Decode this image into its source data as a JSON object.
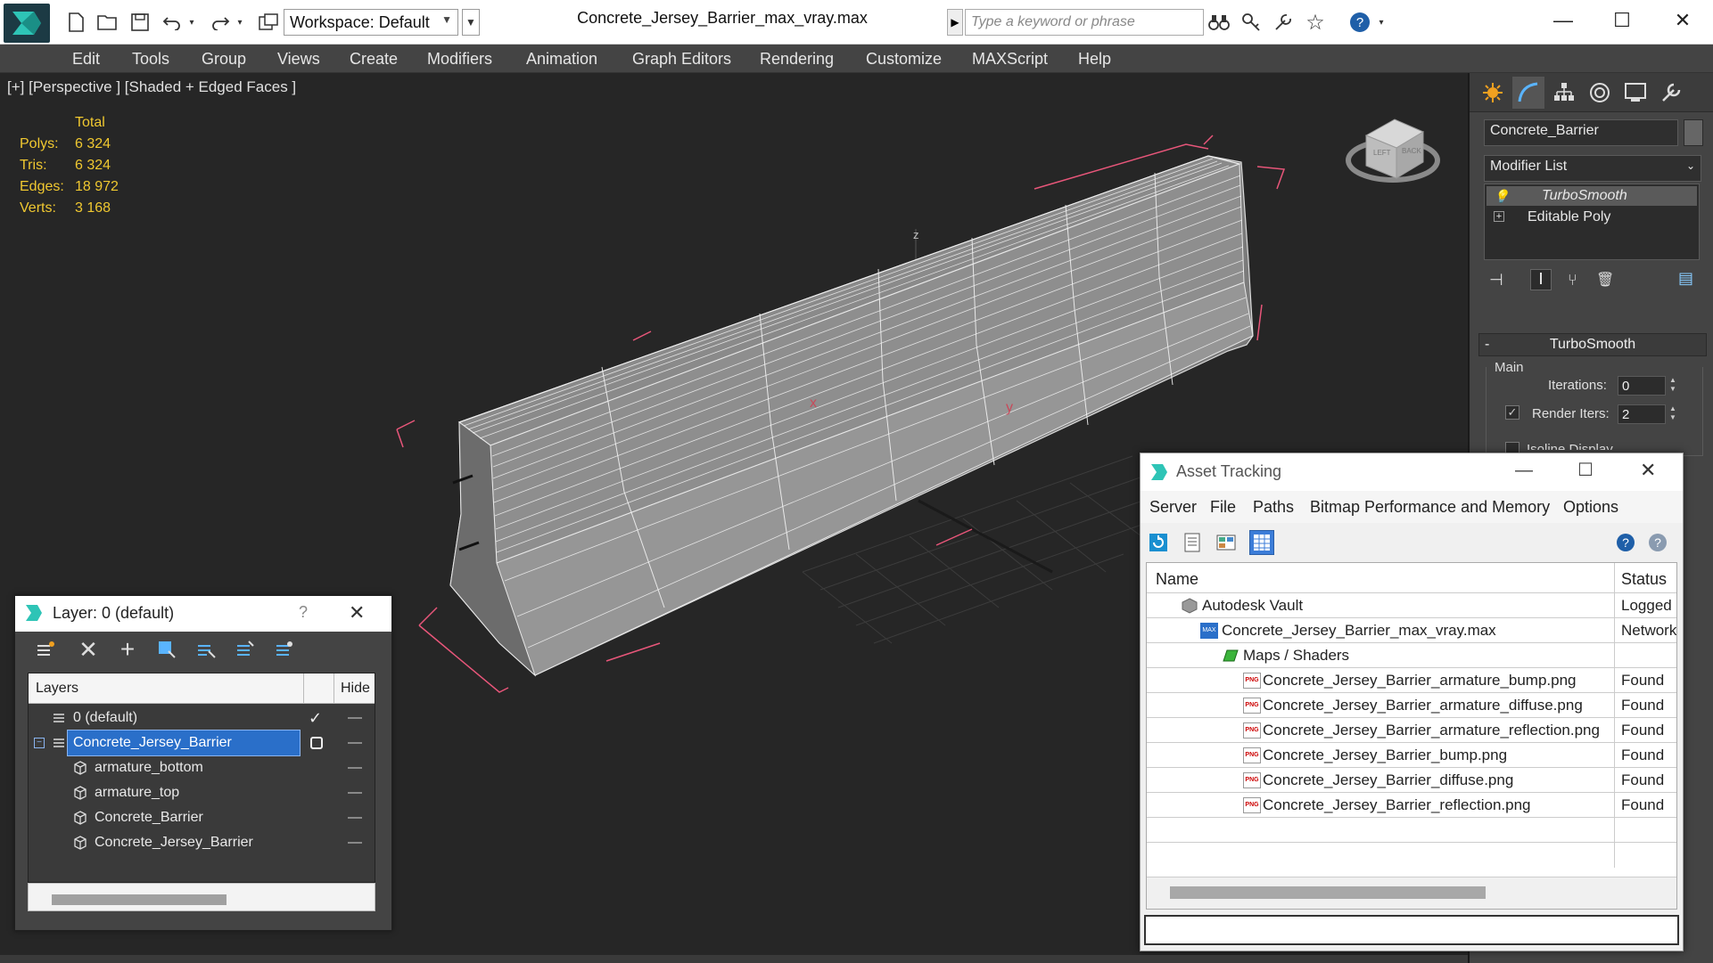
{
  "window": {
    "title": "Concrete_Jersey_Barrier_max_vray.max",
    "workspace_label": "Workspace: Default",
    "search_placeholder": "Type a keyword or phrase"
  },
  "menubar": [
    "Edit",
    "Tools",
    "Group",
    "Views",
    "Create",
    "Modifiers",
    "Animation",
    "Graph Editors",
    "Rendering",
    "Customize",
    "MAXScript",
    "Help"
  ],
  "viewport": {
    "label": "[+] [Perspective ] [Shaded + Edged Faces ]",
    "stats": {
      "header": "Total",
      "polys_label": "Polys:",
      "polys": "6 324",
      "tris_label": "Tris:",
      "tris": "6 324",
      "edges_label": "Edges:",
      "edges": "18 972",
      "verts_label": "Verts:",
      "verts": "3 168"
    },
    "axis_z": "z",
    "axis_x": "x",
    "axis_y": "y",
    "viewcube_left": "LEFT",
    "viewcube_back": "BACK"
  },
  "command_panel": {
    "object_name": "Concrete_Barrier",
    "modifier_list": "Modifier List",
    "stack": [
      "TurboSmooth",
      "Editable Poly"
    ],
    "rollout_title": "TurboSmooth",
    "rollout_minus": "-",
    "group_main": "Main",
    "iterations_label": "Iterations:",
    "iterations_value": "0",
    "render_iters_label": "Render Iters:",
    "render_iters_value": "2",
    "isoline_label": "Isoline Display"
  },
  "layer_dialog": {
    "title": "Layer: 0 (default)",
    "help": "?",
    "col_layers": "Layers",
    "col_hide": "Hide",
    "rows": [
      {
        "name": "0 (default)",
        "level": 0,
        "active": true
      },
      {
        "name": "Concrete_Jersey_Barrier",
        "level": 0,
        "selected": true
      },
      {
        "name": "armature_bottom",
        "level": 1
      },
      {
        "name": "armature_top",
        "level": 1
      },
      {
        "name": "Concrete_Barrier",
        "level": 1
      },
      {
        "name": "Concrete_Jersey_Barrier",
        "level": 1
      }
    ]
  },
  "asset_tracking": {
    "title": "Asset Tracking",
    "menus": [
      "Server",
      "File",
      "Paths",
      "Bitmap Performance and Memory",
      "Options"
    ],
    "col_name": "Name",
    "col_status": "Status",
    "rows": [
      {
        "name": "Autodesk Vault",
        "status": "Logged",
        "level": 1,
        "icon": "vault"
      },
      {
        "name": "Concrete_Jersey_Barrier_max_vray.max",
        "status": "Network",
        "level": 2,
        "icon": "max"
      },
      {
        "name": "Maps / Shaders",
        "status": "",
        "level": 3,
        "icon": "maps"
      },
      {
        "name": "Concrete_Jersey_Barrier_armature_bump.png",
        "status": "Found",
        "level": 4,
        "icon": "png"
      },
      {
        "name": "Concrete_Jersey_Barrier_armature_diffuse.png",
        "status": "Found",
        "level": 4,
        "icon": "png"
      },
      {
        "name": "Concrete_Jersey_Barrier_armature_reflection.png",
        "status": "Found",
        "level": 4,
        "icon": "png"
      },
      {
        "name": "Concrete_Jersey_Barrier_bump.png",
        "status": "Found",
        "level": 4,
        "icon": "png"
      },
      {
        "name": "Concrete_Jersey_Barrier_diffuse.png",
        "status": "Found",
        "level": 4,
        "icon": "png"
      },
      {
        "name": "Concrete_Jersey_Barrier_reflection.png",
        "status": "Found",
        "level": 4,
        "icon": "png"
      }
    ],
    "png_badge": "PNG",
    "max_badge": "MAX"
  },
  "colors": {
    "viewport_bg": "#262626",
    "stats_yellow": "#f0c830",
    "selection_blue": "#2a6fc9",
    "bbox_pink": "#e8567a"
  }
}
